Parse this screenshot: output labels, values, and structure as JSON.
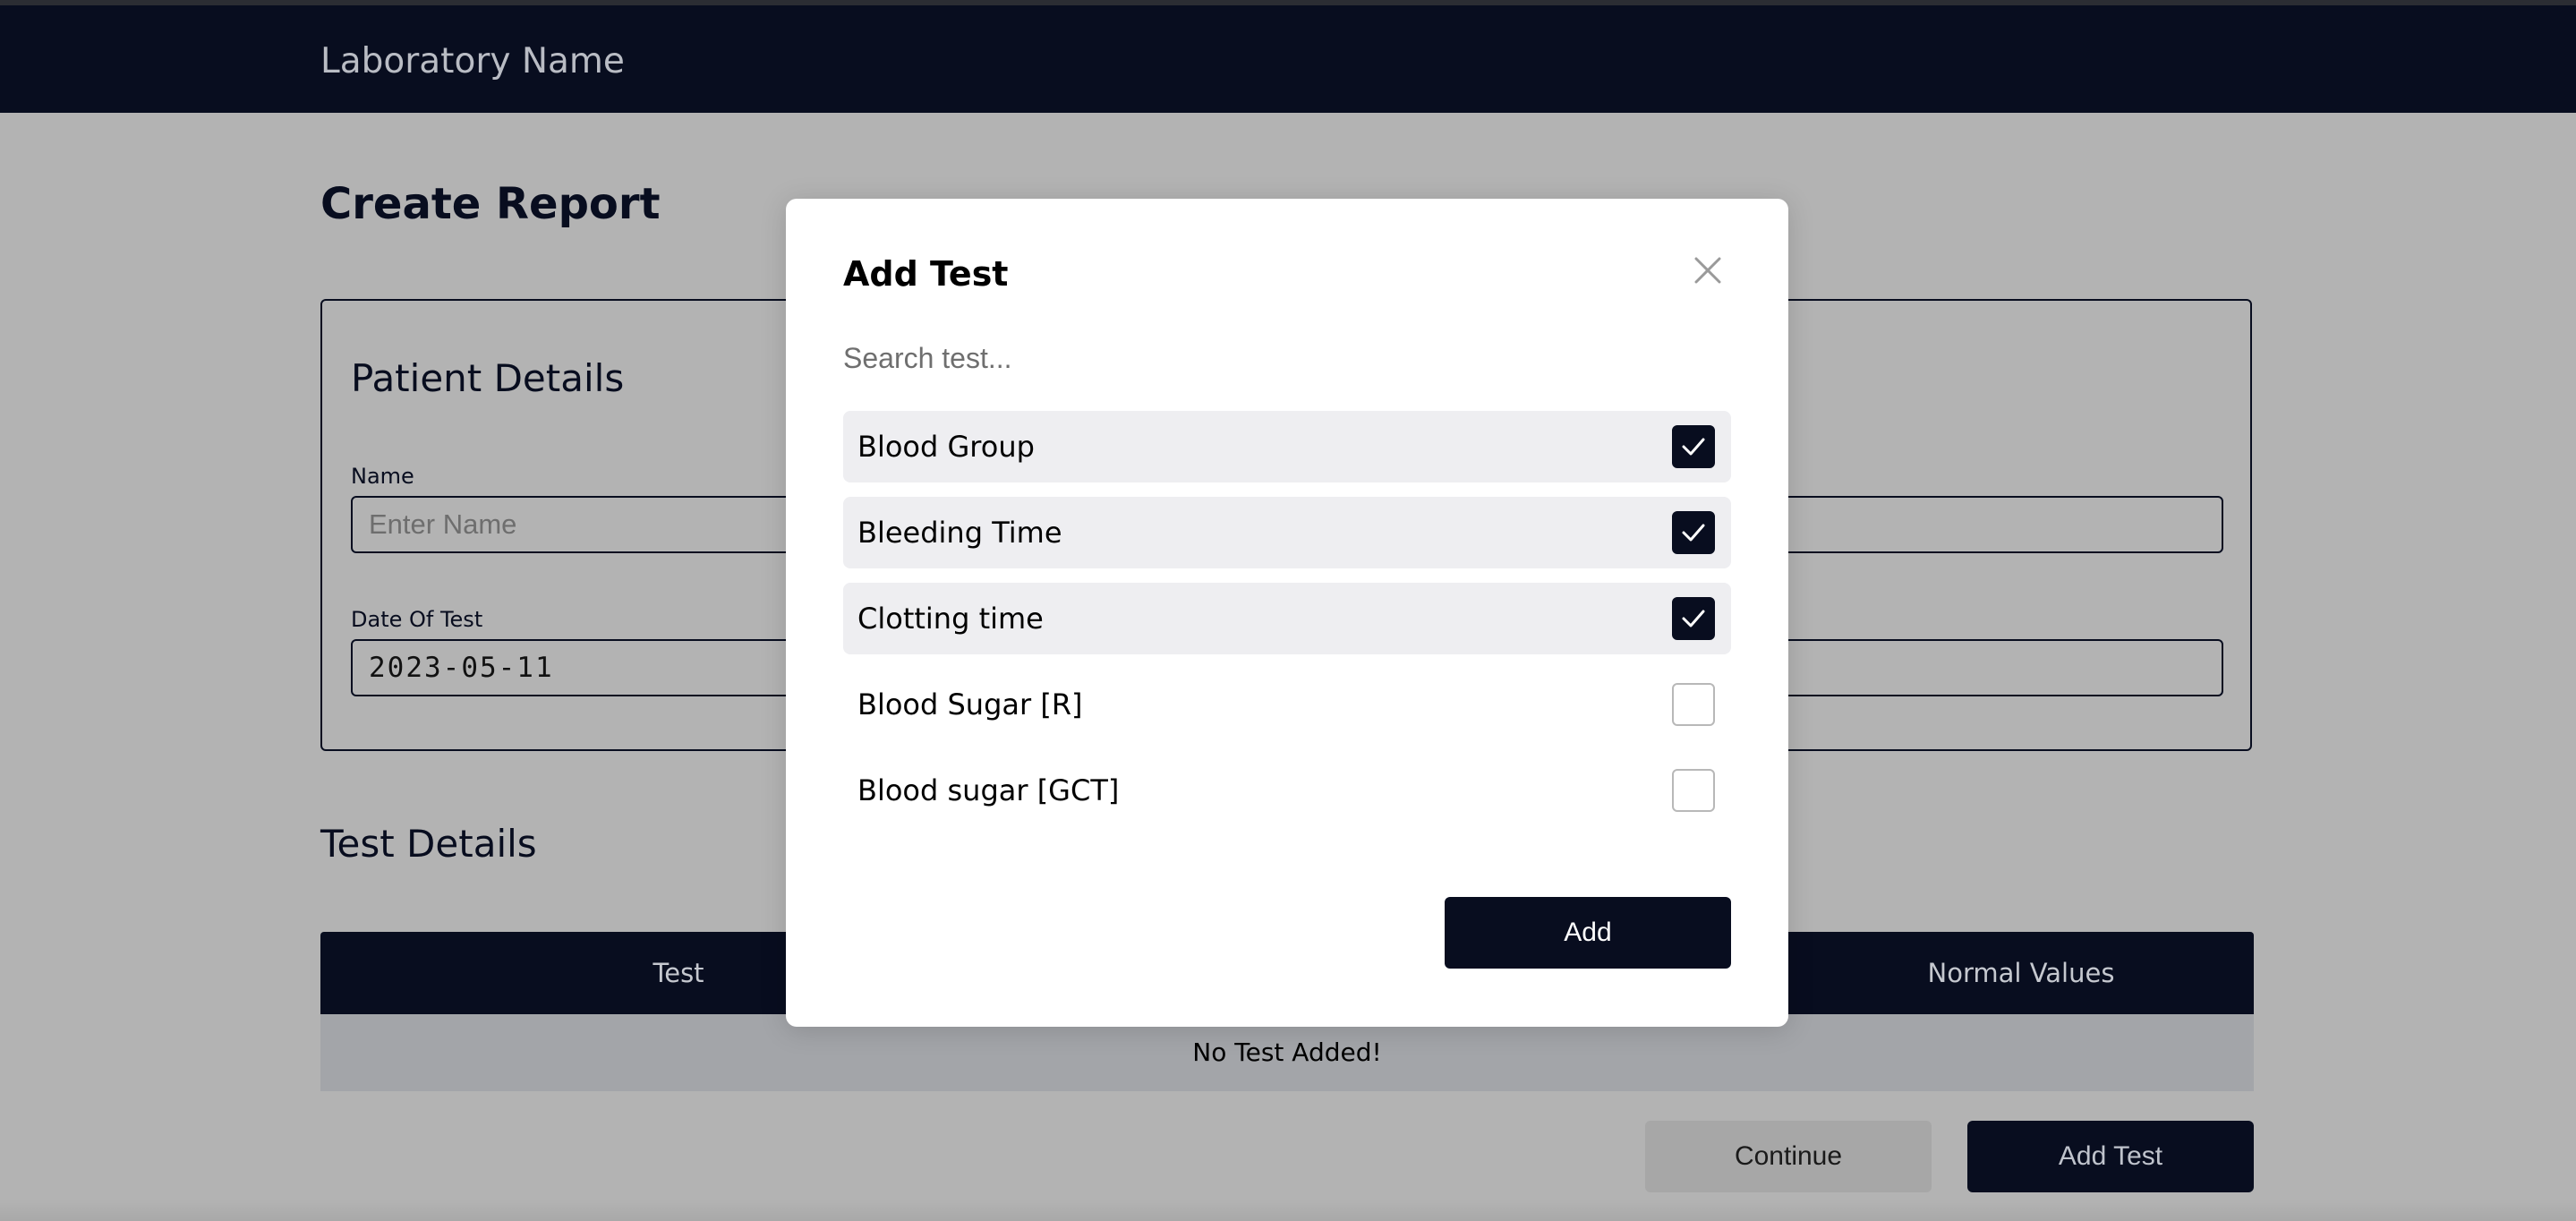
{
  "navbar": {
    "brand": "Laboratory Name"
  },
  "page": {
    "title": "Create Report"
  },
  "patient_details": {
    "title": "Patient Details",
    "name_label": "Name",
    "name_placeholder": "Enter Name",
    "date_label": "Date Of Test",
    "date_value": "2023-05-11"
  },
  "test_details": {
    "title": "Test Details",
    "columns": [
      "Test",
      "Normal Values"
    ],
    "empty_message": "No Test Added!"
  },
  "actions": {
    "continue_label": "Continue",
    "add_test_label": "Add Test"
  },
  "modal": {
    "title": "Add Test",
    "search_placeholder": "Search test...",
    "tests": [
      {
        "label": "Blood Group",
        "checked": true
      },
      {
        "label": "Bleeding Time",
        "checked": true
      },
      {
        "label": "Clotting time",
        "checked": true
      },
      {
        "label": "Blood Sugar [R]",
        "checked": false
      },
      {
        "label": "Blood sugar [GCT]",
        "checked": false
      }
    ],
    "add_label": "Add"
  },
  "colors": {
    "navy": "#080d1f",
    "overlay_bg": "#b3b3b3",
    "checked_row_bg": "#eeeef1"
  },
  "icons": {
    "close": "close-icon",
    "check": "check-icon"
  }
}
